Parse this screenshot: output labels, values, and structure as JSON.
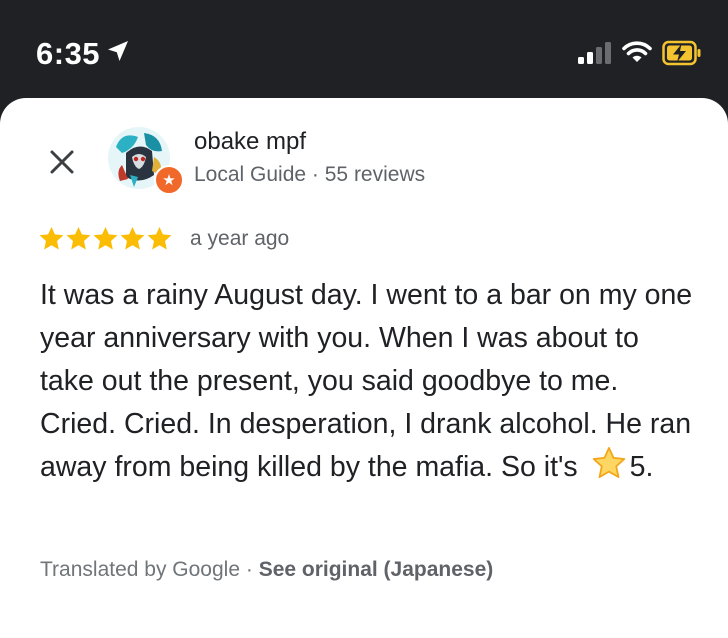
{
  "status_bar": {
    "time": "6:35",
    "icons": [
      "location-arrow-icon",
      "cellular-signal-icon",
      "wifi-icon",
      "battery-charging-icon"
    ]
  },
  "colors": {
    "star": "#fbbc04",
    "guide_badge": "#f0692b",
    "battery": "#f4c430"
  },
  "reviewer": {
    "name": "obake mpf",
    "meta_role": "Local Guide",
    "meta_sep": " · ",
    "meta_reviews": "55 reviews"
  },
  "review": {
    "rating": 5,
    "age": "a year ago",
    "text_before": "It was a rainy August day. I went to a bar on my one year anniversary with you. When I was about to take out the present, you said goodbye to me. Cried. Cried. In desperation, I drank alcohol. He ran away from being killed by the mafia. So it's ",
    "text_after": "5."
  },
  "footer": {
    "translated": "Translated by Google",
    "separator": " · ",
    "see_original": "See original (Japanese)"
  }
}
